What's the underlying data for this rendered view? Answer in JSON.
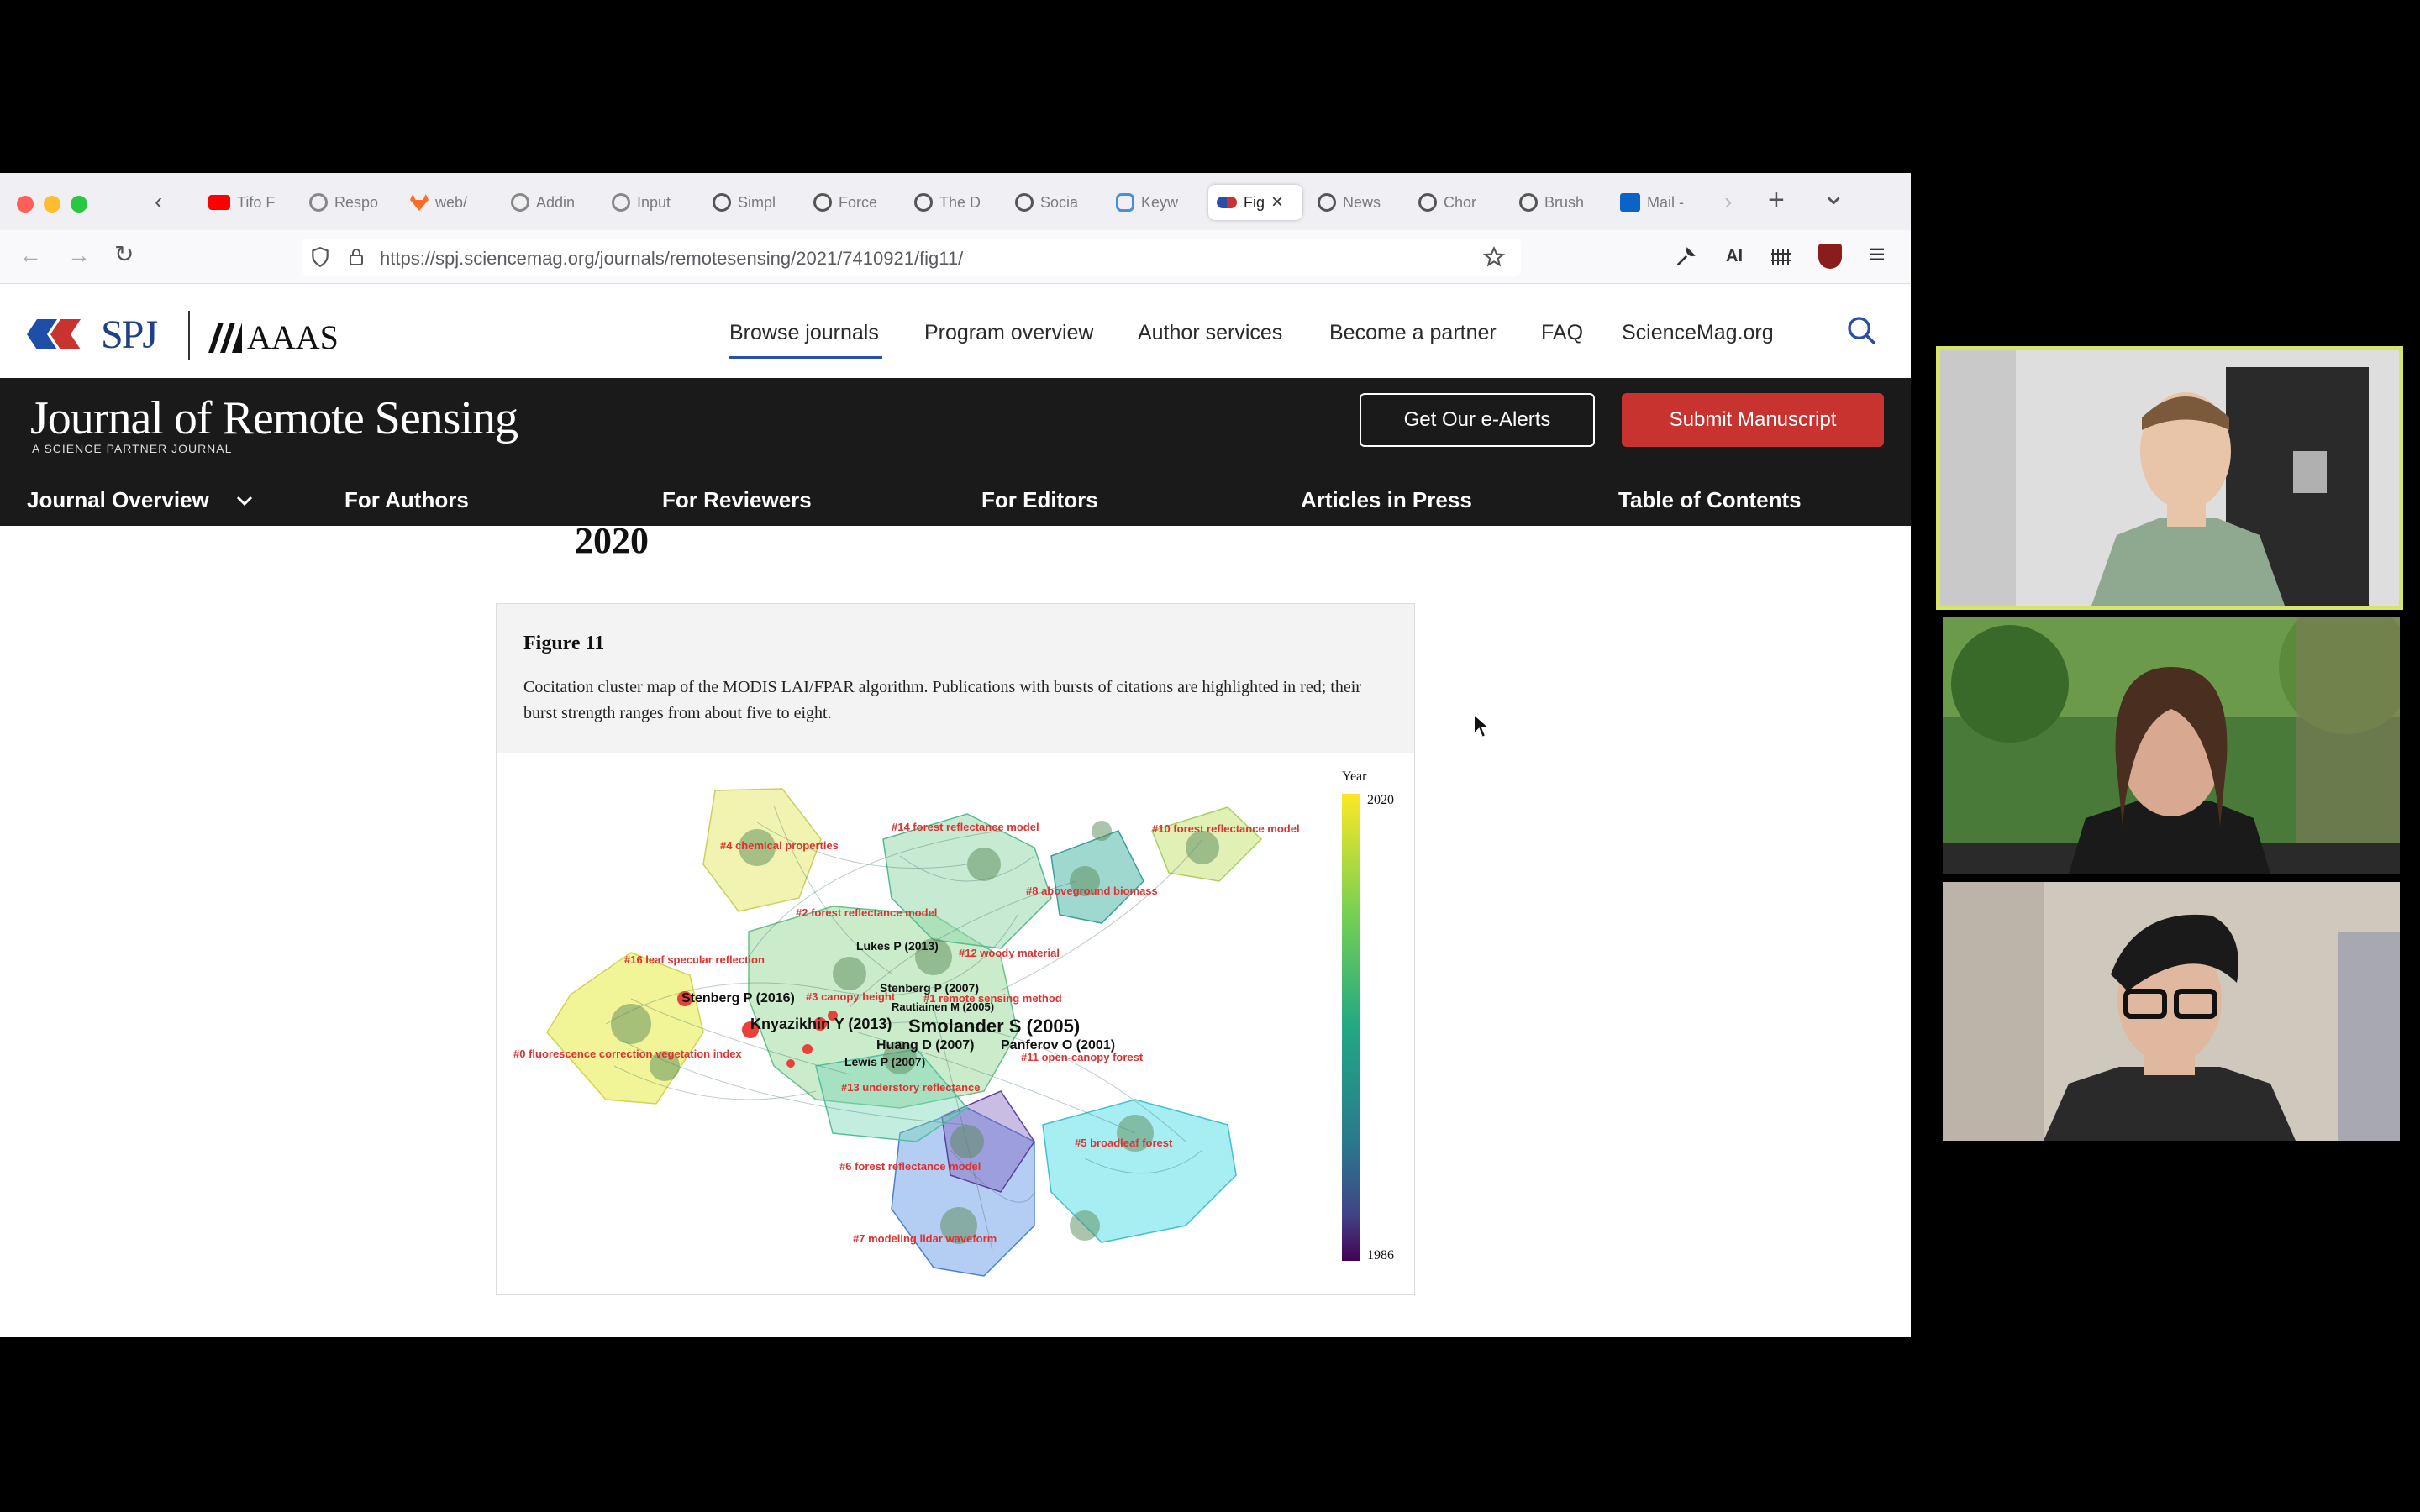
{
  "tabs": [
    {
      "label": "Tifo F"
    },
    {
      "label": "Respo"
    },
    {
      "label": "web/"
    },
    {
      "label": "Addin"
    },
    {
      "label": "Input"
    },
    {
      "label": "Simpl"
    },
    {
      "label": "Force"
    },
    {
      "label": "The D"
    },
    {
      "label": "Socia"
    },
    {
      "label": "Keyw"
    },
    {
      "label": "Fig"
    },
    {
      "label": "News"
    },
    {
      "label": "Chor"
    },
    {
      "label": "Brush"
    },
    {
      "label": "Mail -"
    }
  ],
  "toolbar": {
    "back": "←",
    "forward": "→",
    "reload": "↻",
    "url": "https://spj.sciencemag.org/journals/remotesensing/2021/7410921/fig11/",
    "new_tab": "+",
    "tab_list": "⌄",
    "tab_close": "×",
    "badge": "AI",
    "menu": "≡"
  },
  "site": {
    "brand_spj": "SPJ",
    "brand_aaas": "AAAS",
    "nav": [
      "Browse journals",
      "Program overview",
      "Author services",
      "Become a partner",
      "FAQ",
      "ScienceMag.org"
    ],
    "journal_title": "Journal of Remote Sensing",
    "journal_subtitle": "A SCIENCE PARTNER JOURNAL",
    "alerts_button": "Get Our e-Alerts",
    "submit_button": "Submit Manuscript",
    "journal_nav": [
      "Journal Overview",
      "For Authors",
      "For Reviewers",
      "For Editors",
      "Articles in Press",
      "Table of Contents"
    ]
  },
  "content": {
    "year_heading": "2020",
    "figure_title": "Figure 11",
    "figure_caption": "Cocitation cluster map of the MODIS LAI/FPAR algorithm. Publications with bursts of citations are highlighted in red; their burst strength ranges from about five to eight."
  },
  "figure": {
    "colorbar_title": "Year",
    "colorbar_max": "2020",
    "colorbar_min": "1986",
    "cluster_labels": [
      "#14 forest reflectance model",
      "#10 forest reflectance model",
      "#4 chemical properties",
      "#8 aboveground biomass",
      "#2 forest reflectance model",
      "#12 woody material",
      "#16 leaf specular reflection",
      "#3 canopy height",
      "#1 remote sensing method",
      "#0 fluorescence correction vegetation index",
      "#11 open-canopy forest",
      "#13 understory reflectance",
      "#5 broadleaf forest",
      "#6 forest reflectance model",
      "#7 modeling lidar waveform"
    ],
    "author_labels": [
      "Lukes P (2013)",
      "Stenberg P (2007)",
      "Stenberg P (2016)",
      "Rautiainen M (2005)",
      "Knyazikhin Y (2013)",
      "Smolander S (2005)",
      "Huang D (2007)",
      "Panferov O (2001)",
      "Lewis P (2007)"
    ],
    "colors": {
      "burst": "#e8413a",
      "label": "#e03030"
    }
  }
}
